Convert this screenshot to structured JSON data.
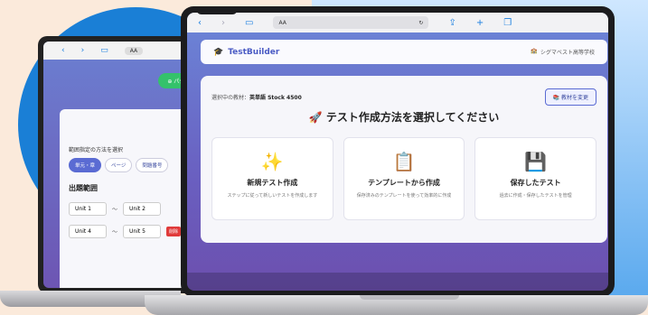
{
  "colors": {
    "accent": "#5a6bd3",
    "brand": "#4a5bc4",
    "danger": "#e03a3a",
    "success": "#34c26b",
    "background": "#fbeadb"
  },
  "back_window": {
    "nav": {
      "back": "‹",
      "forward": "›",
      "book_icon": "book-icon",
      "aa": "AA"
    },
    "pattern_button": "パターン",
    "range_method_label": "範囲指定の方法を選択",
    "chips": [
      "単元・章",
      "ページ",
      "問題番号"
    ],
    "range_heading": "出題範囲",
    "rows": [
      {
        "from": "Unit 1",
        "to": "Unit 2",
        "delete": ""
      },
      {
        "from": "Unit 4",
        "to": "Unit 5",
        "delete": "削除"
      }
    ],
    "tilde": "〜"
  },
  "front_window": {
    "toolbar": {
      "back": "‹",
      "forward": "›",
      "book": "book-icon",
      "aa": "AA",
      "reload": "↻",
      "share": "share-icon",
      "add": "+",
      "tabs": "tabs-icon"
    },
    "app": {
      "name": "TestBuilder",
      "school": "シグマベスト高等学校"
    },
    "material_label": "選択中の教材：",
    "material_name": "英単語 Stock 4500",
    "change_button": "教材を変更",
    "heading": "テスト作成方法を選択してください",
    "options": [
      {
        "icon": "✨",
        "title": "新規テスト作成",
        "desc": "ステップに従って新しいテストを作成します"
      },
      {
        "icon": "📋",
        "title": "テンプレートから作成",
        "desc": "保存済みのテンプレートを使って効率的に作成"
      },
      {
        "icon": "💾",
        "title": "保存したテスト",
        "desc": "過去に作成・保存したテストを管理"
      }
    ]
  }
}
